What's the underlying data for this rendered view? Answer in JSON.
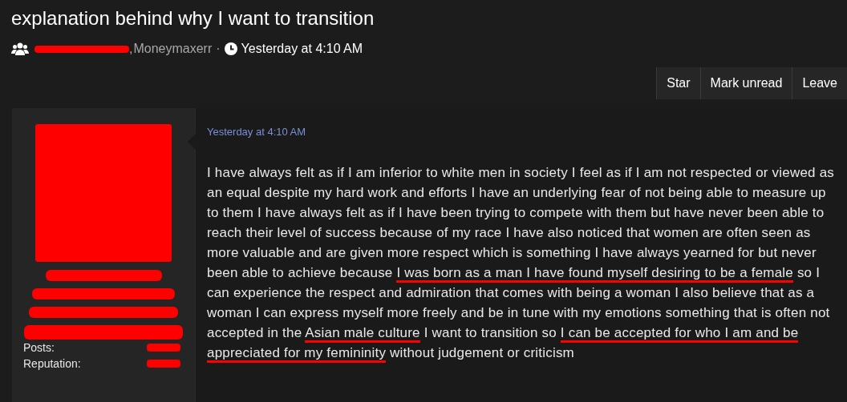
{
  "thread": {
    "title": "explanation behind why I want to transition",
    "author_prefix": ",",
    "author": "Moneymaxerr",
    "separator": "·",
    "time": "Yesterday at 4:10 AM"
  },
  "actions": [
    "Star",
    "Mark unread",
    "Leave"
  ],
  "user": {
    "stats": [
      {
        "label": "Posts:"
      },
      {
        "label": "Reputation:"
      }
    ]
  },
  "post": {
    "time": "Yesterday at 4:10 AM",
    "segments": [
      {
        "text": "I have always felt as if I am inferior to white men in society I feel as if I am not respected or viewed as an equal despite my hard work and efforts I have an underlying fear of not being able to measure up to them I have always felt as if I have been trying to compete with them but have never been able to reach their level of success because of my race I have also noticed that women are often seen as more valuable and are given more respect which is something I have always yearned for but never been able to achieve because ",
        "underlined": false
      },
      {
        "text": "I was born as a man I have found myself desiring to be a female",
        "underlined": true
      },
      {
        "text": " so I can experience the respect and admiration that comes with being a woman I also believe that as a woman I can express myself more freely and be in tune with my emotions something that is often not accepted in the ",
        "underlined": false
      },
      {
        "text": "Asian male culture",
        "underlined": true
      },
      {
        "text": " I want to transition so ",
        "underlined": false
      },
      {
        "text": "I can be accepted for who I am and be appreciated for my femininity",
        "underlined": true
      },
      {
        "text": " without judgement or criticism",
        "underlined": false
      }
    ]
  }
}
